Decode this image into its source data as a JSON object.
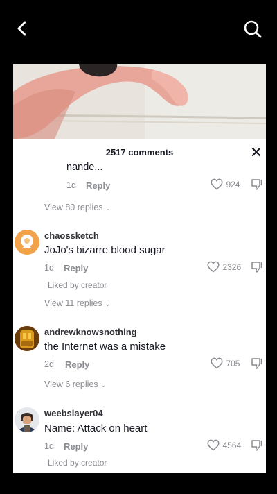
{
  "header": {
    "back_icon": "chevron-left-icon",
    "search_icon": "search-icon"
  },
  "comments_panel": {
    "title": "2517 comments",
    "close_icon": "close-icon",
    "partial_comment": {
      "text": "nande...",
      "age": "1d",
      "reply_label": "Reply",
      "likes": "924",
      "view_replies": "View 80 replies"
    },
    "comments": [
      {
        "username": "chaossketch",
        "text": "JoJo's bizarre blood sugar",
        "age": "1d",
        "reply_label": "Reply",
        "likes": "2326",
        "liked_by": "Liked by creator",
        "view_replies": "View 11 replies"
      },
      {
        "username": "andrewknowsnothing",
        "text": "the Internet was a mistake",
        "age": "2d",
        "reply_label": "Reply",
        "likes": "705",
        "view_replies": "View 6 replies"
      },
      {
        "username": "weebslayer04",
        "text": "Name: Attack on heart",
        "age": "1d",
        "reply_label": "Reply",
        "likes": "4564",
        "liked_by": "Liked by creator"
      }
    ]
  }
}
